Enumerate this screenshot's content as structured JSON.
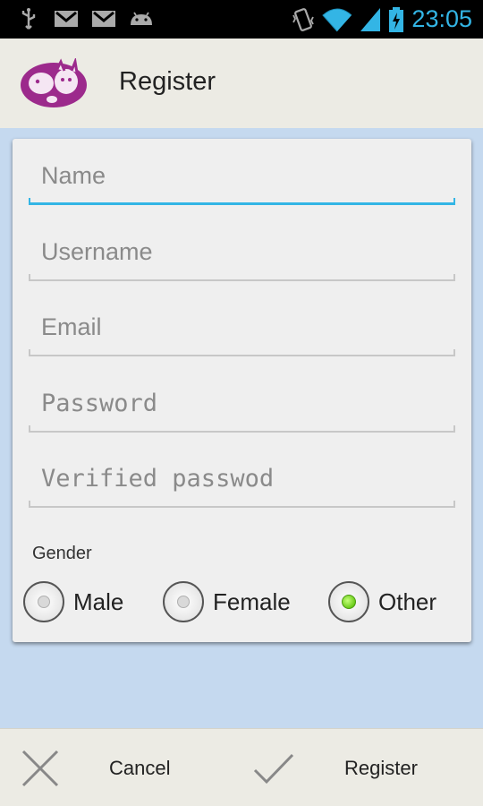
{
  "status_bar": {
    "time": "23:05",
    "icons": [
      "usb-icon",
      "gmail-icon",
      "gmail-icon",
      "android-icon",
      "vibrate-icon",
      "wifi-icon",
      "signal-icon",
      "battery-charging-icon"
    ]
  },
  "action_bar": {
    "title": "Register",
    "logo_icon": "pets-logo-icon"
  },
  "form": {
    "name_placeholder": "Name",
    "username_placeholder": "Username",
    "email_placeholder": "Email",
    "password_placeholder": "Password",
    "verify_placeholder": "Verified passwod",
    "gender_label": "Gender",
    "gender_options": [
      {
        "label": "Male",
        "checked": false
      },
      {
        "label": "Female",
        "checked": false
      },
      {
        "label": "Other",
        "checked": true
      }
    ]
  },
  "bottom_bar": {
    "cancel_label": "Cancel",
    "register_label": "Register"
  },
  "colors": {
    "accent": "#33b5e5",
    "background": "#c5d9ef",
    "bar": "#ecebe4",
    "card": "#efefef",
    "radio_checked": "#6bcc1a",
    "logo": "#9c2a8c"
  }
}
